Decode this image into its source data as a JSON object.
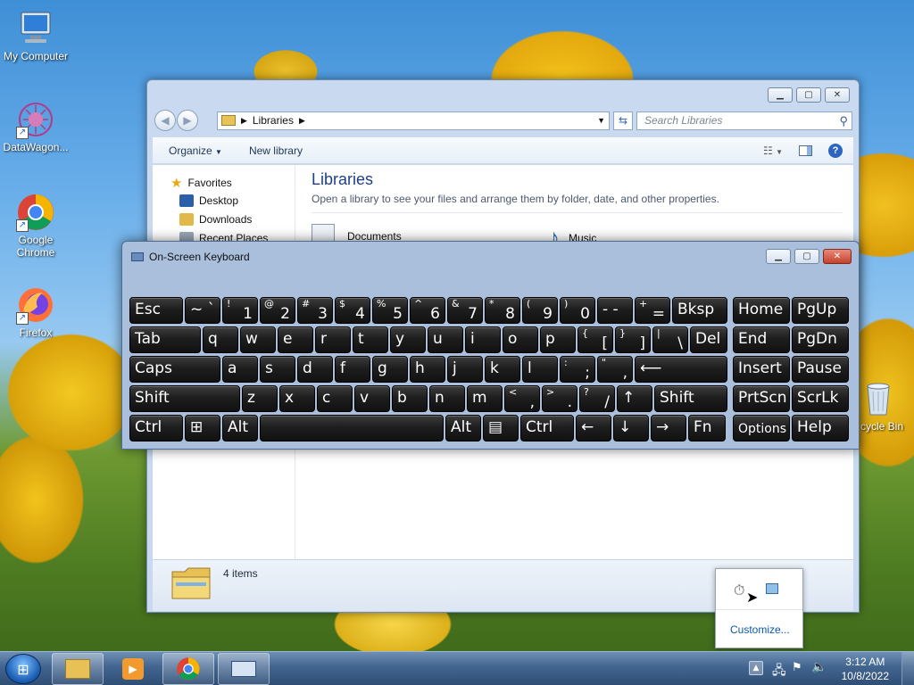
{
  "desktop": {
    "icons": [
      {
        "label": "My Computer",
        "icon": "computer-icon"
      },
      {
        "label": "DataWagon...",
        "icon": "datawagon-icon"
      },
      {
        "label": "Google Chrome",
        "icon": "chrome-icon"
      },
      {
        "label": "Firefox",
        "icon": "firefox-icon"
      },
      {
        "label": "cycle Bin",
        "icon": "recycle-bin-icon"
      }
    ]
  },
  "explorer": {
    "address": "Libraries",
    "search_placeholder": "Search Libraries",
    "toolbar": {
      "organize": "Organize",
      "new_library": "New library"
    },
    "nav": {
      "favorites": "Favorites",
      "desktop": "Desktop",
      "downloads": "Downloads",
      "recent": "Recent Places"
    },
    "title": "Libraries",
    "subtitle": "Open a library to see your files and arrange them by folder, date, and other properties.",
    "libraries": [
      "Documents",
      "Music"
    ],
    "status": "4 items"
  },
  "osk": {
    "title": "On-Screen Keyboard",
    "rows": [
      [
        [
          "Esc",
          ""
        ],
        [
          "~ `",
          ""
        ],
        [
          "1",
          "!"
        ],
        [
          "2",
          "@"
        ],
        [
          "3",
          "#"
        ],
        [
          "4",
          "$"
        ],
        [
          "5",
          "%"
        ],
        [
          "6",
          "^"
        ],
        [
          "7",
          "&"
        ],
        [
          "8",
          "*"
        ],
        [
          "9",
          "("
        ],
        [
          "0",
          ")"
        ],
        [
          "- -",
          ""
        ],
        [
          "=",
          "+"
        ],
        [
          "Bksp",
          ""
        ],
        [
          "Home",
          ""
        ],
        [
          "PgUp",
          ""
        ]
      ],
      [
        [
          "Tab",
          ""
        ],
        [
          "q",
          ""
        ],
        [
          "w",
          ""
        ],
        [
          "e",
          ""
        ],
        [
          "r",
          ""
        ],
        [
          "t",
          ""
        ],
        [
          "y",
          ""
        ],
        [
          "u",
          ""
        ],
        [
          "i",
          ""
        ],
        [
          "o",
          ""
        ],
        [
          "p",
          ""
        ],
        [
          "[",
          "{"
        ],
        [
          "]",
          "}"
        ],
        [
          "\\",
          "|"
        ],
        [
          "Del",
          ""
        ],
        [
          "End",
          ""
        ],
        [
          "PgDn",
          ""
        ]
      ],
      [
        [
          "Caps",
          ""
        ],
        [
          "a",
          ""
        ],
        [
          "s",
          ""
        ],
        [
          "d",
          ""
        ],
        [
          "f",
          ""
        ],
        [
          "g",
          ""
        ],
        [
          "h",
          ""
        ],
        [
          "j",
          ""
        ],
        [
          "k",
          ""
        ],
        [
          "l",
          ""
        ],
        [
          ";",
          ":"
        ],
        [
          ",",
          "\""
        ],
        [
          "⟵",
          ""
        ],
        [
          "Insert",
          ""
        ],
        [
          "Pause",
          ""
        ]
      ],
      [
        [
          "Shift",
          ""
        ],
        [
          "z",
          ""
        ],
        [
          "x",
          ""
        ],
        [
          "c",
          ""
        ],
        [
          "v",
          ""
        ],
        [
          "b",
          ""
        ],
        [
          "n",
          ""
        ],
        [
          "m",
          ""
        ],
        [
          ",",
          "<"
        ],
        [
          ".",
          ">"
        ],
        [
          "/",
          "?"
        ],
        [
          "↑",
          ""
        ],
        [
          "Shift",
          ""
        ],
        [
          "PrtScn",
          ""
        ],
        [
          "ScrLk",
          ""
        ]
      ],
      [
        [
          "Ctrl",
          ""
        ],
        [
          "⊞",
          ""
        ],
        [
          "Alt",
          ""
        ],
        [
          "",
          ""
        ],
        [
          "Alt",
          ""
        ],
        [
          "▤",
          ""
        ],
        [
          "Ctrl",
          ""
        ],
        [
          "←",
          ""
        ],
        [
          "↓",
          ""
        ],
        [
          "→",
          ""
        ],
        [
          "Fn",
          ""
        ],
        [
          "Options",
          ""
        ],
        [
          "Help",
          ""
        ]
      ]
    ]
  },
  "tray_popup": {
    "customize": "Customize..."
  },
  "taskbar": {
    "time": "3:12 AM",
    "date": "10/8/2022"
  }
}
